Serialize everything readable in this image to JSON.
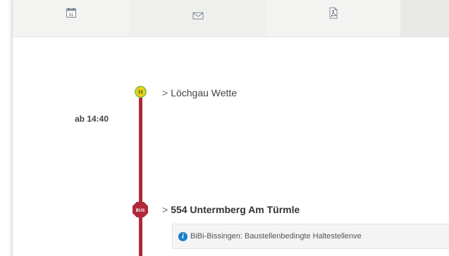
{
  "toolbar": {
    "items": [
      {
        "icon": "calendar-icon",
        "text": "31"
      },
      {
        "icon": "mail-icon"
      },
      {
        "icon": "pdf-icon"
      },
      {
        "icon": "blank"
      }
    ]
  },
  "timeline": {
    "departure_time": "ab 14:40",
    "line_color": "#b0283a",
    "stop1": {
      "icon": "bus-stop-h-icon",
      "symbol": "H",
      "chevron": ">",
      "name": "Löchgau Wette"
    },
    "stop2": {
      "icon": "bus-icon",
      "symbol": "BUS",
      "chevron": ">",
      "name": "554 Untermberg Am Türmle"
    },
    "notice": {
      "icon": "info-icon",
      "symbol": "i",
      "text": "BiBi-Bissingen: Baustellenbedingte Haltestellenve"
    }
  },
  "colors": {
    "accent": "#b0283a",
    "info": "#1b7fc9",
    "stop_h": "#8dc63f"
  }
}
